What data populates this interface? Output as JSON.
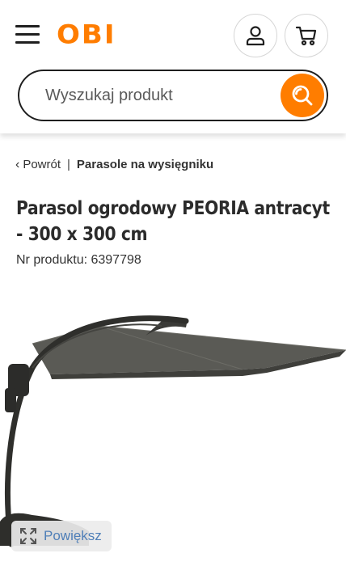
{
  "header": {
    "logo_text": "OBI",
    "search": {
      "placeholder": "Wyszukaj produkt"
    }
  },
  "icons": {
    "menu": "hamburger-menu-icon",
    "account": "user-icon",
    "cart": "cart-icon",
    "search": "search-icon",
    "back": "chevron-left-icon",
    "zoom": "expand-icon"
  },
  "colors": {
    "brand": "#ff7d00",
    "text": "#2b2b2b",
    "link": "#4f7fb8"
  },
  "breadcrumb": {
    "back_label": "Powrót",
    "separator": "|",
    "category": "Parasole na wysięgniku"
  },
  "product": {
    "title": "Parasol ogrodowy PEORIA antracyt - 300 x 300 cm",
    "sku_label": "Nr produktu: 6397798"
  },
  "gallery": {
    "zoom_label": "Powiększ"
  }
}
